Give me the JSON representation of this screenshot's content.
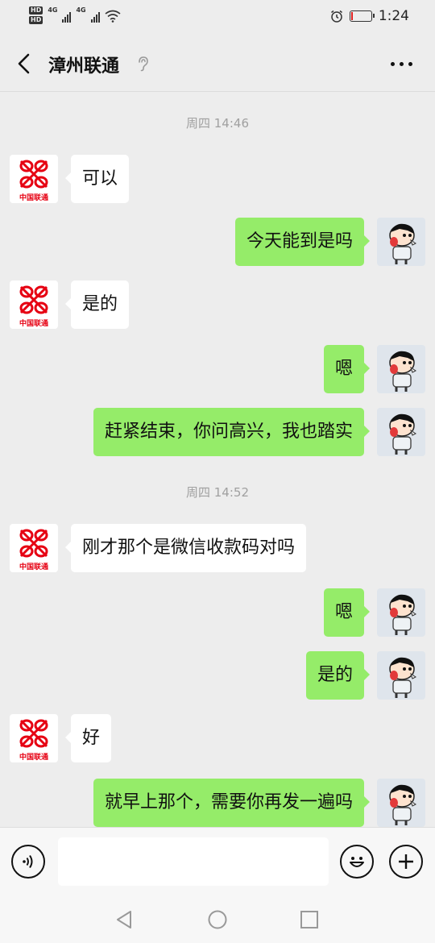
{
  "status_bar": {
    "hd1": "HD",
    "hd2": "HD",
    "net1": "4G",
    "net2": "4G",
    "time": "1:24",
    "battery_level": 0.1,
    "icons": [
      "signal-icon",
      "wifi-icon",
      "alarm-icon",
      "battery-icon"
    ]
  },
  "header": {
    "title": "漳州联通",
    "back_icon": "chevron-left-icon",
    "ear_icon": "ear-icon",
    "more_icon": "more-icon"
  },
  "messages": [
    {
      "type": "time",
      "text": "周四 14:46"
    },
    {
      "type": "msg",
      "side": "left",
      "text": "可以"
    },
    {
      "type": "msg",
      "side": "right",
      "text": "今天能到是吗"
    },
    {
      "type": "msg",
      "side": "left",
      "text": "是的"
    },
    {
      "type": "msg",
      "side": "right",
      "text": "嗯"
    },
    {
      "type": "msg",
      "side": "right",
      "text": "赶紧结束，你问高兴，我也踏实"
    },
    {
      "type": "time",
      "text": "周四 14:52"
    },
    {
      "type": "msg",
      "side": "left",
      "text": "刚才那个是微信收款码对吗"
    },
    {
      "type": "msg",
      "side": "right",
      "text": "嗯"
    },
    {
      "type": "msg",
      "side": "right",
      "text": "是的"
    },
    {
      "type": "msg",
      "side": "left",
      "text": "好"
    },
    {
      "type": "msg",
      "side": "right",
      "text": "就早上那个，需要你再发一遍吗"
    }
  ],
  "contact_avatar": {
    "label": "中国联通",
    "brand_color": "#e60012"
  },
  "colors": {
    "my_bubble": "#95ec69",
    "their_bubble": "#ffffff",
    "background": "#ededed"
  },
  "input_bar": {
    "voice_icon": "voice-icon",
    "input_value": "",
    "emoji_icon": "emoji-icon",
    "plus_icon": "plus-icon"
  },
  "system_nav": {
    "icons": [
      "back-triangle-icon",
      "home-circle-icon",
      "recents-square-icon"
    ]
  }
}
